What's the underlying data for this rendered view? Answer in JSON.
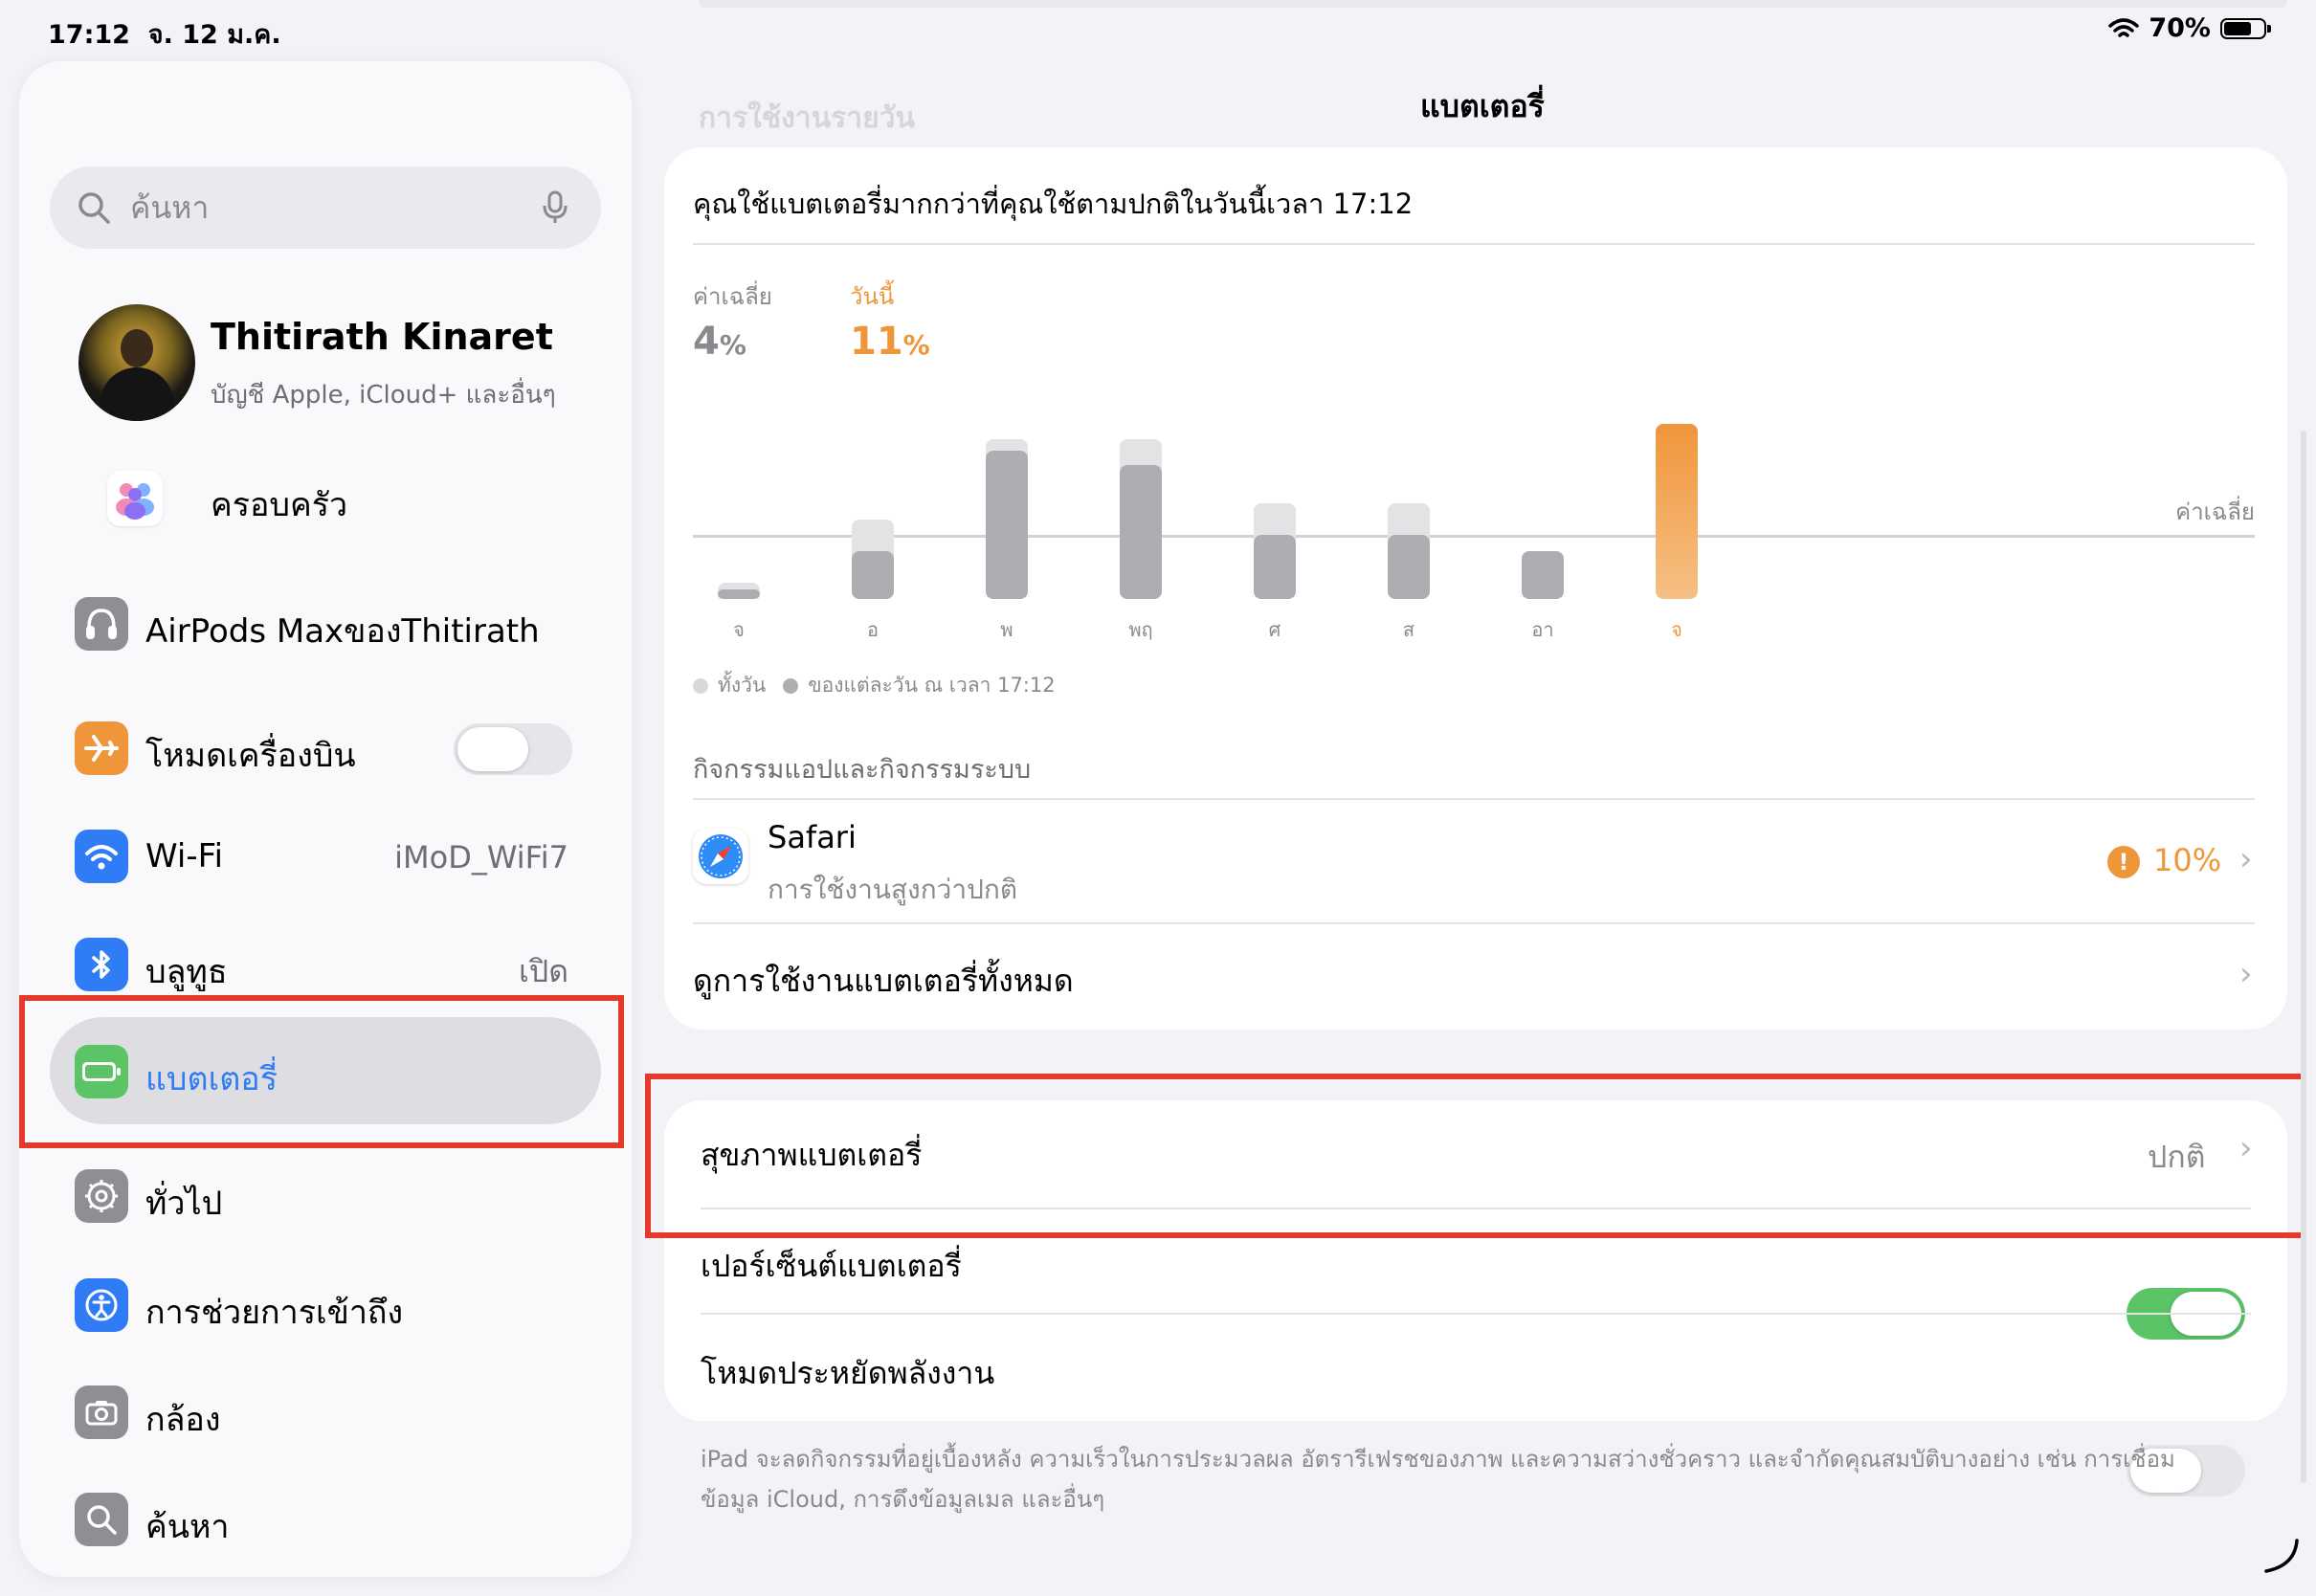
{
  "status": {
    "time": "17:12",
    "date": "จ. 12 ม.ค.",
    "battery": "70%",
    "battery_level": 0.7
  },
  "sidebar": {
    "search_placeholder": "ค้นหา",
    "profile": {
      "name": "Thitirath Kinaret",
      "subtitle": "บัญชี Apple, iCloud+ และอื่นๆ"
    },
    "family": "ครอบครัว",
    "airpods": "AirPods MaxของThitirath",
    "airplane": {
      "label": "โหมดเครื่องบิน",
      "on": false
    },
    "wifi": {
      "label": "Wi-Fi",
      "value": "iMoD_WiFi7"
    },
    "bluetooth": {
      "label": "บลูทูธ",
      "value": "เปิด"
    },
    "battery": "แบตเตอรี่",
    "general": "ทั่วไป",
    "accessibility": "การช่วยการเข้าถึง",
    "camera": "กล้อง",
    "search_item": "ค้นหา"
  },
  "main": {
    "ghost_title": "การใช้งานรายวัน",
    "title": "แบตเตอรี่",
    "usage_note": "คุณใช้แบตเตอรี่มากกว่าที่คุณใช้ตามปกติในวันนี้เวลา 17:12",
    "average_label": "ค่าเฉลี่ย",
    "average_value": "4",
    "today_label": "วันนี้",
    "today_value": "11",
    "percent_sign": "%",
    "avg_line_label": "ค่าเฉลี่ย",
    "legend_allday": "ทั้งวัน",
    "legend_at_time": "ของแต่ละวัน ณ เวลา 17:12",
    "activity_header": "กิจกรรมแอปและกิจกรรมระบบ",
    "app": {
      "name": "Safari",
      "note": "การใช้งานสูงกว่าปกติ",
      "value": "10%"
    },
    "view_all": "ดูการใช้งานแบตเตอรี่ทั้งหมด",
    "health": {
      "label": "สุขภาพแบตเตอรี่",
      "value": "ปกติ"
    },
    "percentage": {
      "label": "เปอร์เซ็นต์แบตเตอรี่",
      "on": true
    },
    "low_power": {
      "label": "โหมดประหยัดพลังงาน",
      "on": false
    },
    "footnote_1": "iPad จะลดกิจกรรมที่อยู่เบื้องหลัง ความเร็วในการประมวลผล อัตรารีเฟรชของภาพ และความสว่างชั่วคราว และจำกัดคุณสมบัติบางอย่าง เช่น การเชื่อม",
    "footnote_2": "ข้อมูล iCloud, การดึงข้อมูลเมล และอื่นๆ"
  },
  "colors": {
    "accent": "#f0963a",
    "blue": "#2f7cf6",
    "green": "#5ac466",
    "highlight": "#e5392c"
  },
  "chart_data": {
    "type": "bar",
    "categories": [
      "จ",
      "อ",
      "พ",
      "พฤ",
      "ศ",
      "ส",
      "อา",
      "จ"
    ],
    "series": [
      {
        "name": "ทั้งวัน",
        "values": [
          1.0,
          5.0,
          10.0,
          10.0,
          6.0,
          6.0,
          3.0,
          11.0
        ]
      },
      {
        "name": "ของแต่ละวัน ณ เวลา 17:12",
        "values": [
          0.6,
          3.0,
          9.3,
          8.4,
          4.0,
          4.0,
          3.0,
          11.0
        ]
      }
    ],
    "average": 4,
    "highlight_index": 7,
    "ylim": [
      0,
      12
    ]
  }
}
